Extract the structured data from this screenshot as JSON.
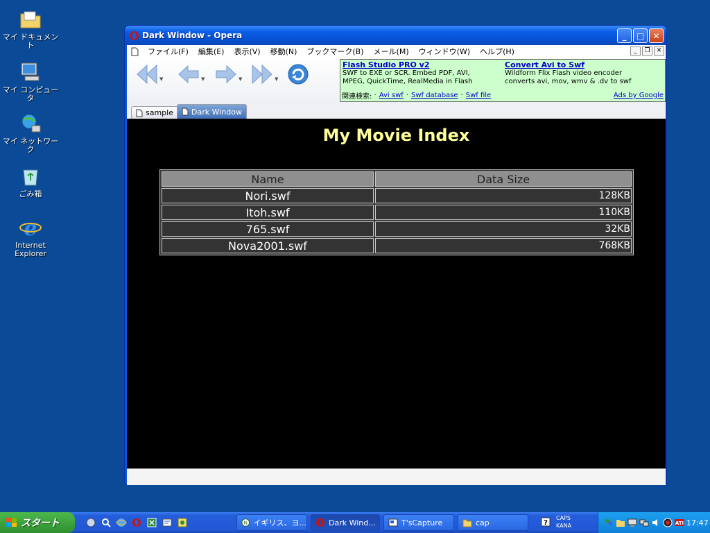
{
  "desktop": {
    "icons": [
      {
        "label": "マイ ドキュメント"
      },
      {
        "label": "マイ コンピュータ"
      },
      {
        "label": "マイ ネットワーク"
      },
      {
        "label": "ごみ箱"
      },
      {
        "label": "Internet\nExplorer"
      }
    ]
  },
  "window": {
    "title": "Dark Window - Opera",
    "menu": [
      "ファイル(F)",
      "編集(E)",
      "表示(V)",
      "移動(N)",
      "ブックマーク(B)",
      "メール(M)",
      "ウィンドウ(W)",
      "ヘルプ(H)"
    ],
    "mdi_buttons": [
      "_",
      "❐",
      "✕"
    ],
    "ads": [
      {
        "title": "Flash Studio PRO v2",
        "lines": [
          "SWF to EXE or SCR. Embed PDF, AVI,",
          "MPEG, QuickTime, RealMedia in Flash"
        ]
      },
      {
        "title": "Convert Avi to Swf",
        "lines": [
          "Wildform Flix Flash video encoder",
          "converts avi, mov, wmv & .dv to swf"
        ]
      }
    ],
    "ad_links_label": "関連検索:",
    "ad_links": [
      "Avi swf",
      "Swf database",
      "Swf file"
    ],
    "ads_by": "Ads by Google",
    "tabs": [
      {
        "label": "sample",
        "active": false
      },
      {
        "label": "Dark Window",
        "active": true
      }
    ]
  },
  "page": {
    "title": "My Movie Index",
    "table": {
      "headers": [
        "Name",
        "Data Size"
      ],
      "rows": [
        {
          "name": "Nori.swf",
          "size": "128KB"
        },
        {
          "name": "Itoh.swf",
          "size": "110KB"
        },
        {
          "name": "765.swf",
          "size": "32KB"
        },
        {
          "name": "Nova2001.swf",
          "size": "768KB"
        }
      ]
    }
  },
  "taskbar": {
    "start_label": "スタート",
    "tasks": [
      {
        "label": "イギリス、ヨ...",
        "active": false
      },
      {
        "label": "Dark Wind...",
        "active": true
      },
      {
        "label": "T'sCapture",
        "active": false
      },
      {
        "label": "cap",
        "active": false
      }
    ],
    "ime_caps": "CAPS",
    "ime_kana": "KANA",
    "clock": "17:47"
  },
  "colors": {
    "desktop": "#0a4a96",
    "page_title": "#ffff99",
    "ad_background": "#ccffcc"
  }
}
